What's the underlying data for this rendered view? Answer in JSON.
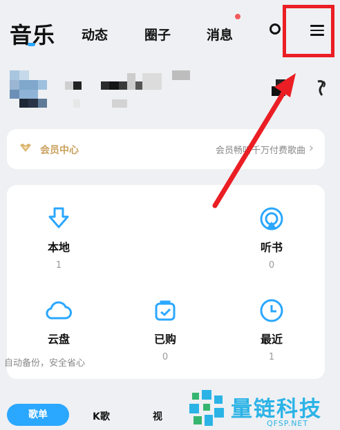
{
  "nav": {
    "tabs": [
      {
        "label": "音乐",
        "active": true
      },
      {
        "label": "动态"
      },
      {
        "label": "圈子"
      },
      {
        "label": "消息",
        "has_dot": true
      }
    ],
    "search_icon": "search-icon",
    "menu_icon": "hamburger-menu-icon"
  },
  "vip": {
    "icon": "crown-icon",
    "label": "会员中心",
    "promo": "会员畅听千万付费歌曲",
    "arrow": "›"
  },
  "features": {
    "items": [
      {
        "icon": "download-icon",
        "name": "本地",
        "count": "1"
      },
      {
        "icon": "audiobook-icon",
        "name": "听书",
        "count": "0"
      },
      {
        "icon": "cloud-icon",
        "name": "云盘",
        "subtitle": "自动备份，安全省心"
      },
      {
        "icon": "bag-check-icon",
        "name": "已购",
        "count": "0"
      },
      {
        "icon": "clock-icon",
        "name": "最近",
        "count": "1"
      }
    ]
  },
  "bottom_tabs": {
    "active": "歌单",
    "items": [
      "K歌",
      "视"
    ]
  },
  "watermark": {
    "title": "量链科技",
    "sub": "QFSP.NET"
  },
  "colors": {
    "accent": "#2aa7ff",
    "annotation_red": "#ea1e24",
    "vip_gold": "#c9a15d"
  }
}
